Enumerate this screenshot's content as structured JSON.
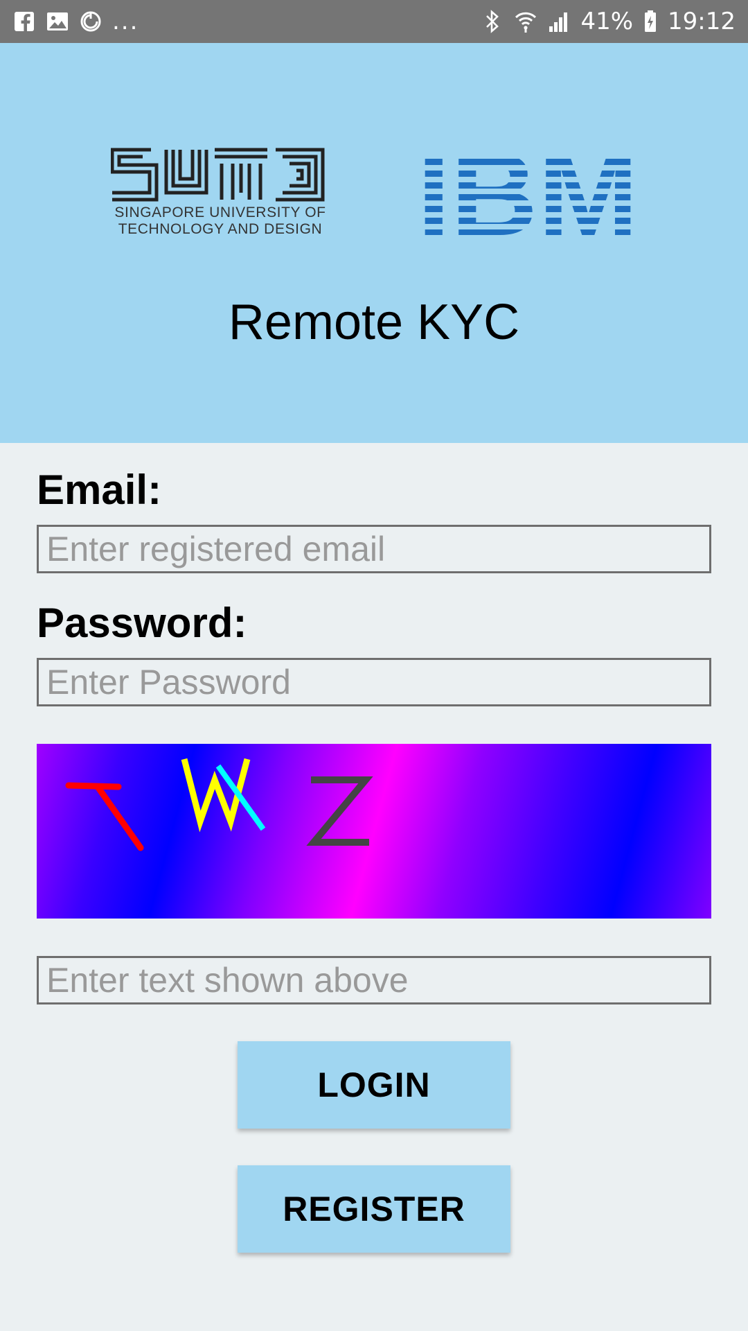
{
  "status_bar": {
    "left_icons": [
      "facebook-icon",
      "gallery-icon",
      "sync-icon"
    ],
    "overflow": "...",
    "right_icons": [
      "bluetooth-icon",
      "wifi-icon",
      "signal-icon",
      "battery-icon"
    ],
    "battery": "41%",
    "time": "19:12"
  },
  "header": {
    "logo_left_caption_line1": "SINGAPORE UNIVERSITY OF",
    "logo_left_caption_line2": "TECHNOLOGY AND DESIGN",
    "logo_left_wordmark": "SUTD",
    "logo_right_wordmark": "IBM",
    "title": "Remote KYC",
    "background": "#a0d6f1"
  },
  "form": {
    "email_label": "Email:",
    "email_placeholder": "Enter registered email",
    "password_label": "Password:",
    "password_placeholder": "Enter Password",
    "captcha_chars": [
      "T",
      "W",
      "Z"
    ],
    "captcha_placeholder": "Enter text shown above"
  },
  "buttons": {
    "login": "LOGIN",
    "register": "REGISTER",
    "color": "#a0d6f1"
  }
}
